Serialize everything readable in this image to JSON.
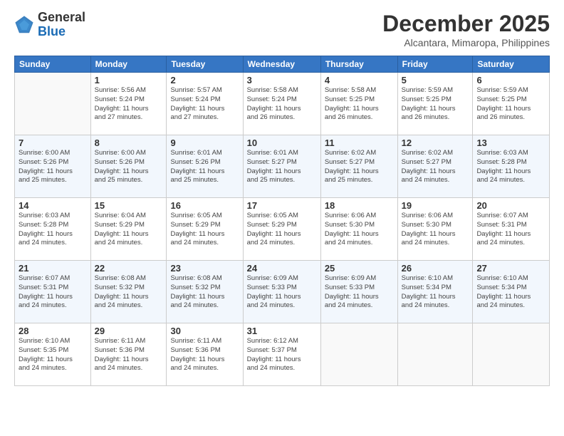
{
  "header": {
    "logo": {
      "general": "General",
      "blue": "Blue"
    },
    "title": "December 2025",
    "location": "Alcantara, Mimaropa, Philippines"
  },
  "weekdays": [
    "Sunday",
    "Monday",
    "Tuesday",
    "Wednesday",
    "Thursday",
    "Friday",
    "Saturday"
  ],
  "weeks": [
    [
      {
        "day": "",
        "sunrise": "",
        "sunset": "",
        "daylight": ""
      },
      {
        "day": "1",
        "sunrise": "Sunrise: 5:56 AM",
        "sunset": "Sunset: 5:24 PM",
        "daylight": "Daylight: 11 hours and 27 minutes."
      },
      {
        "day": "2",
        "sunrise": "Sunrise: 5:57 AM",
        "sunset": "Sunset: 5:24 PM",
        "daylight": "Daylight: 11 hours and 27 minutes."
      },
      {
        "day": "3",
        "sunrise": "Sunrise: 5:58 AM",
        "sunset": "Sunset: 5:24 PM",
        "daylight": "Daylight: 11 hours and 26 minutes."
      },
      {
        "day": "4",
        "sunrise": "Sunrise: 5:58 AM",
        "sunset": "Sunset: 5:25 PM",
        "daylight": "Daylight: 11 hours and 26 minutes."
      },
      {
        "day": "5",
        "sunrise": "Sunrise: 5:59 AM",
        "sunset": "Sunset: 5:25 PM",
        "daylight": "Daylight: 11 hours and 26 minutes."
      },
      {
        "day": "6",
        "sunrise": "Sunrise: 5:59 AM",
        "sunset": "Sunset: 5:25 PM",
        "daylight": "Daylight: 11 hours and 26 minutes."
      }
    ],
    [
      {
        "day": "7",
        "sunrise": "Sunrise: 6:00 AM",
        "sunset": "Sunset: 5:26 PM",
        "daylight": "Daylight: 11 hours and 25 minutes."
      },
      {
        "day": "8",
        "sunrise": "Sunrise: 6:00 AM",
        "sunset": "Sunset: 5:26 PM",
        "daylight": "Daylight: 11 hours and 25 minutes."
      },
      {
        "day": "9",
        "sunrise": "Sunrise: 6:01 AM",
        "sunset": "Sunset: 5:26 PM",
        "daylight": "Daylight: 11 hours and 25 minutes."
      },
      {
        "day": "10",
        "sunrise": "Sunrise: 6:01 AM",
        "sunset": "Sunset: 5:27 PM",
        "daylight": "Daylight: 11 hours and 25 minutes."
      },
      {
        "day": "11",
        "sunrise": "Sunrise: 6:02 AM",
        "sunset": "Sunset: 5:27 PM",
        "daylight": "Daylight: 11 hours and 25 minutes."
      },
      {
        "day": "12",
        "sunrise": "Sunrise: 6:02 AM",
        "sunset": "Sunset: 5:27 PM",
        "daylight": "Daylight: 11 hours and 24 minutes."
      },
      {
        "day": "13",
        "sunrise": "Sunrise: 6:03 AM",
        "sunset": "Sunset: 5:28 PM",
        "daylight": "Daylight: 11 hours and 24 minutes."
      }
    ],
    [
      {
        "day": "14",
        "sunrise": "Sunrise: 6:03 AM",
        "sunset": "Sunset: 5:28 PM",
        "daylight": "Daylight: 11 hours and 24 minutes."
      },
      {
        "day": "15",
        "sunrise": "Sunrise: 6:04 AM",
        "sunset": "Sunset: 5:29 PM",
        "daylight": "Daylight: 11 hours and 24 minutes."
      },
      {
        "day": "16",
        "sunrise": "Sunrise: 6:05 AM",
        "sunset": "Sunset: 5:29 PM",
        "daylight": "Daylight: 11 hours and 24 minutes."
      },
      {
        "day": "17",
        "sunrise": "Sunrise: 6:05 AM",
        "sunset": "Sunset: 5:29 PM",
        "daylight": "Daylight: 11 hours and 24 minutes."
      },
      {
        "day": "18",
        "sunrise": "Sunrise: 6:06 AM",
        "sunset": "Sunset: 5:30 PM",
        "daylight": "Daylight: 11 hours and 24 minutes."
      },
      {
        "day": "19",
        "sunrise": "Sunrise: 6:06 AM",
        "sunset": "Sunset: 5:30 PM",
        "daylight": "Daylight: 11 hours and 24 minutes."
      },
      {
        "day": "20",
        "sunrise": "Sunrise: 6:07 AM",
        "sunset": "Sunset: 5:31 PM",
        "daylight": "Daylight: 11 hours and 24 minutes."
      }
    ],
    [
      {
        "day": "21",
        "sunrise": "Sunrise: 6:07 AM",
        "sunset": "Sunset: 5:31 PM",
        "daylight": "Daylight: 11 hours and 24 minutes."
      },
      {
        "day": "22",
        "sunrise": "Sunrise: 6:08 AM",
        "sunset": "Sunset: 5:32 PM",
        "daylight": "Daylight: 11 hours and 24 minutes."
      },
      {
        "day": "23",
        "sunrise": "Sunrise: 6:08 AM",
        "sunset": "Sunset: 5:32 PM",
        "daylight": "Daylight: 11 hours and 24 minutes."
      },
      {
        "day": "24",
        "sunrise": "Sunrise: 6:09 AM",
        "sunset": "Sunset: 5:33 PM",
        "daylight": "Daylight: 11 hours and 24 minutes."
      },
      {
        "day": "25",
        "sunrise": "Sunrise: 6:09 AM",
        "sunset": "Sunset: 5:33 PM",
        "daylight": "Daylight: 11 hours and 24 minutes."
      },
      {
        "day": "26",
        "sunrise": "Sunrise: 6:10 AM",
        "sunset": "Sunset: 5:34 PM",
        "daylight": "Daylight: 11 hours and 24 minutes."
      },
      {
        "day": "27",
        "sunrise": "Sunrise: 6:10 AM",
        "sunset": "Sunset: 5:34 PM",
        "daylight": "Daylight: 11 hours and 24 minutes."
      }
    ],
    [
      {
        "day": "28",
        "sunrise": "Sunrise: 6:10 AM",
        "sunset": "Sunset: 5:35 PM",
        "daylight": "Daylight: 11 hours and 24 minutes."
      },
      {
        "day": "29",
        "sunrise": "Sunrise: 6:11 AM",
        "sunset": "Sunset: 5:36 PM",
        "daylight": "Daylight: 11 hours and 24 minutes."
      },
      {
        "day": "30",
        "sunrise": "Sunrise: 6:11 AM",
        "sunset": "Sunset: 5:36 PM",
        "daylight": "Daylight: 11 hours and 24 minutes."
      },
      {
        "day": "31",
        "sunrise": "Sunrise: 6:12 AM",
        "sunset": "Sunset: 5:37 PM",
        "daylight": "Daylight: 11 hours and 24 minutes."
      },
      {
        "day": "",
        "sunrise": "",
        "sunset": "",
        "daylight": ""
      },
      {
        "day": "",
        "sunrise": "",
        "sunset": "",
        "daylight": ""
      },
      {
        "day": "",
        "sunrise": "",
        "sunset": "",
        "daylight": ""
      }
    ]
  ]
}
